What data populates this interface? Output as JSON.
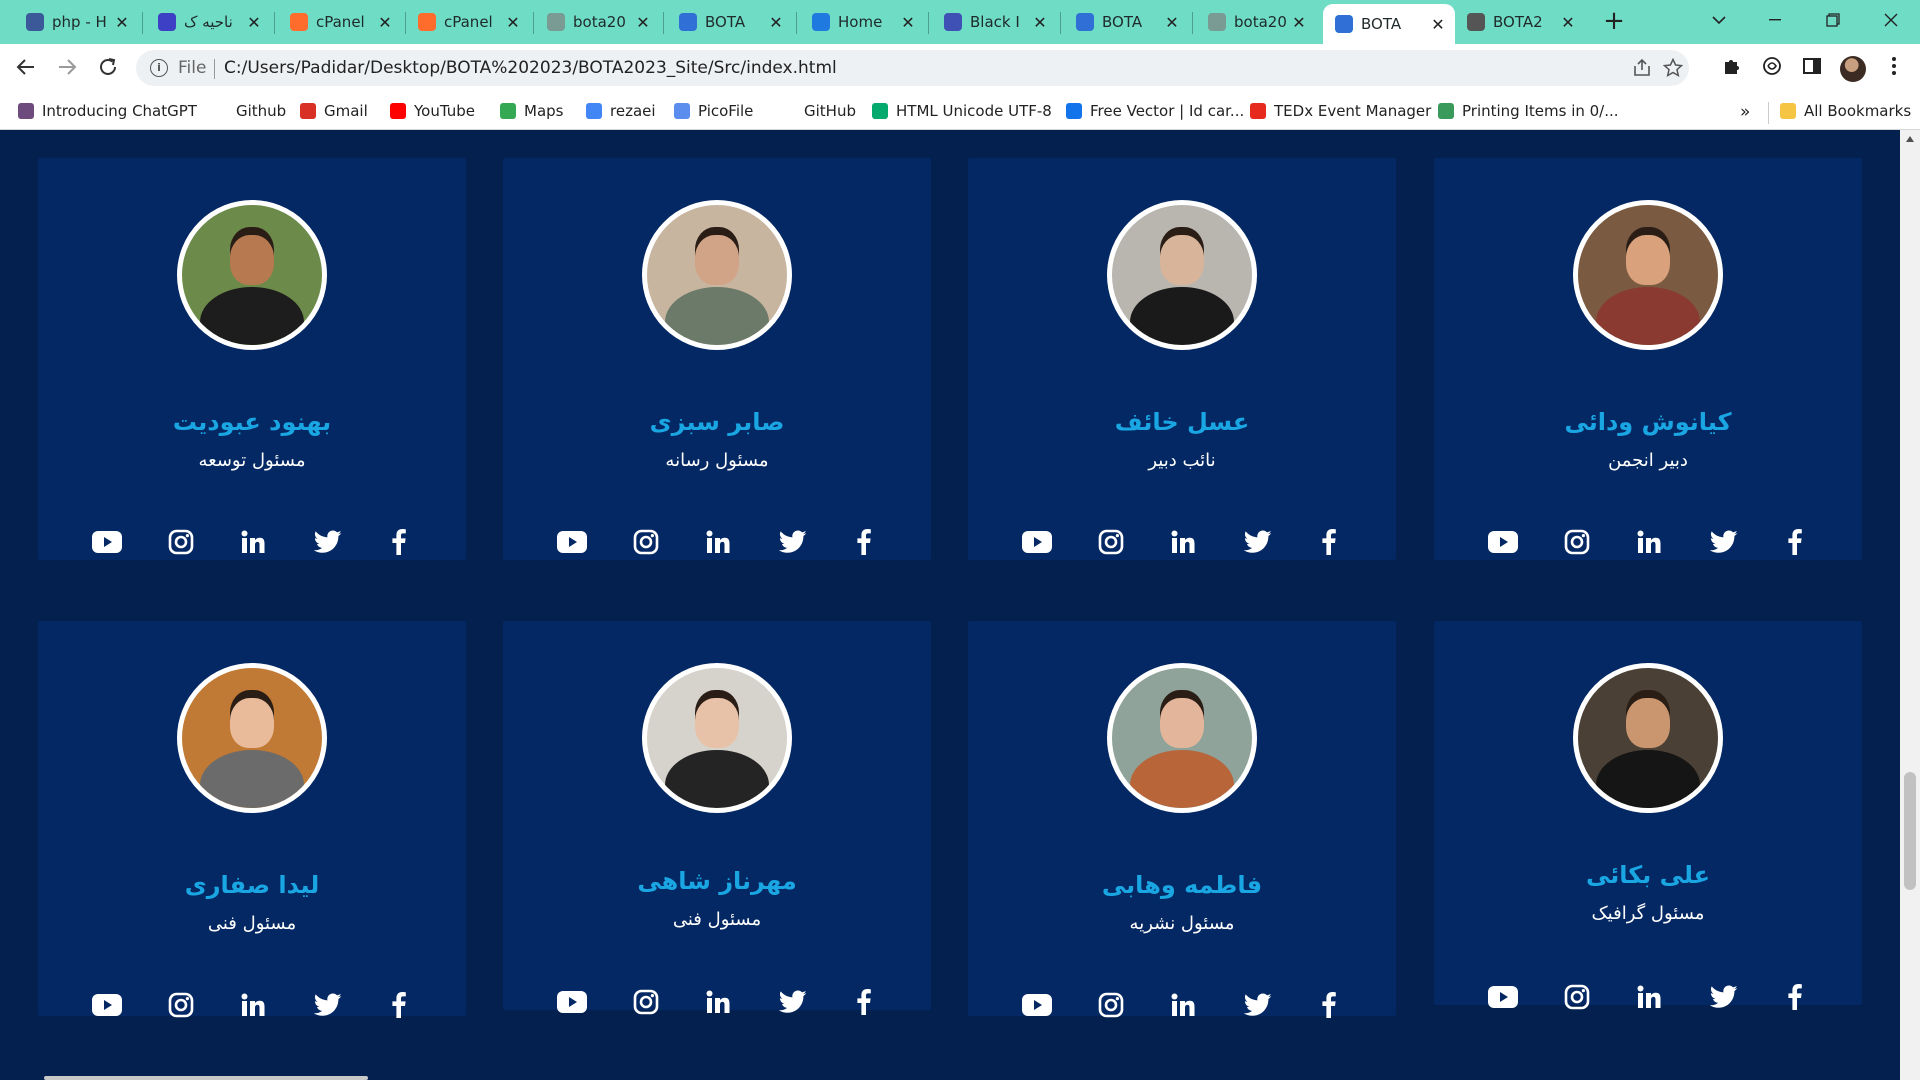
{
  "browser": {
    "tabs": [
      {
        "title": "php - H",
        "icon": "php-doc-icon",
        "color": "#3b5998",
        "active": false
      },
      {
        "title": "ناحیه ک",
        "icon": "circle-p-icon",
        "color": "#3d3fc4",
        "active": false
      },
      {
        "title": "cPanel",
        "icon": "cpanel-icon",
        "color": "#ff6c2c",
        "active": false
      },
      {
        "title": "cPanel",
        "icon": "cpanel-icon",
        "color": "#ff6c2c",
        "active": false
      },
      {
        "title": "bota20",
        "icon": "github-icon",
        "color": "#7a9a94",
        "active": false
      },
      {
        "title": "BOTA",
        "icon": "bota-grid-icon",
        "color": "#2f6fd6",
        "active": false
      },
      {
        "title": "Home",
        "icon": "canva-c-icon",
        "color": "#1f7ae0",
        "active": false
      },
      {
        "title": "Black I",
        "icon": "printer-icon",
        "color": "#3f51b5",
        "active": false
      },
      {
        "title": "BOTA",
        "icon": "bota-grid-icon",
        "color": "#2f6fd6",
        "active": false
      },
      {
        "title": "bota20",
        "icon": "github-icon",
        "color": "#7a9a94",
        "active": false
      },
      {
        "title": "BOTA",
        "icon": "bota-grid-icon",
        "color": "#2f6fd6",
        "active": true
      },
      {
        "title": "BOTA2",
        "icon": "github-icon",
        "color": "#555555",
        "active": false
      }
    ],
    "address": {
      "scheme": "File",
      "url": "C:/Users/Padidar/Desktop/BOTA%202023/BOTA2023_Site/Src/index.html"
    },
    "bookmarks": [
      {
        "label": "Introducing ChatGPT",
        "icon": "chatgpt-icon",
        "color": "#6e4b7d"
      },
      {
        "label": "Github",
        "icon": "github-icon",
        "color": "#ffffff"
      },
      {
        "label": "Gmail",
        "icon": "gmail-icon",
        "color": "#d93025"
      },
      {
        "label": "YouTube",
        "icon": "youtube-icon",
        "color": "#ff0000"
      },
      {
        "label": "Maps",
        "icon": "maps-pin-icon",
        "color": "#34a853"
      },
      {
        "label": "rezaei",
        "icon": "google-g-icon",
        "color": "#4285f4"
      },
      {
        "label": "PicoFile",
        "icon": "picofile-icon",
        "color": "#5b8def"
      },
      {
        "label": "GitHub",
        "icon": "github-icon",
        "color": "#ffffff"
      },
      {
        "label": "HTML Unicode UTF-8",
        "icon": "w3schools-icon",
        "color": "#04aa6d"
      },
      {
        "label": "Free Vector | Id car...",
        "icon": "freepik-icon",
        "color": "#1273eb"
      },
      {
        "label": "TEDx Event Manager",
        "icon": "ted-icon",
        "color": "#e62b1e"
      },
      {
        "label": "Printing Items in 0/...",
        "icon": "link-icon",
        "color": "#3a9a5b"
      }
    ],
    "bookmarks_more": "»",
    "all_bookmarks": "All Bookmarks"
  },
  "team": [
    {
      "name": "کیانوش ودائی",
      "role": "دبیر انجمن",
      "avatar_bg": "#7a5a40",
      "skin": "#d9a27d",
      "shirt": "#8a3a30"
    },
    {
      "name": "عسل خائف",
      "role": "نائب دبیر",
      "avatar_bg": "#b9b6b0",
      "skin": "#d7b49a",
      "shirt": "#1a1a1a"
    },
    {
      "name": "صابر سبزی",
      "role": "مسئول رسانه",
      "avatar_bg": "#c8b5a0",
      "skin": "#d2a487",
      "shirt": "#6c7a6a"
    },
    {
      "name": "بهنود عبودیت",
      "role": "مسئول توسعه",
      "avatar_bg": "#6c8a4a",
      "skin": "#b77a50",
      "shirt": "#1d1d1d"
    },
    {
      "name": "علی بکائی",
      "role": "مسئول گرافیک",
      "avatar_bg": "#4b4035",
      "skin": "#c99670",
      "shirt": "#151515"
    },
    {
      "name": "فاطمه وهابی",
      "role": "مسئول نشریه",
      "avatar_bg": "#8fa39a",
      "skin": "#e3b59a",
      "shirt": "#b8653a"
    },
    {
      "name": "مهرناز شاهی",
      "role": "مسئول فنی",
      "avatar_bg": "#d6d2cc",
      "skin": "#e7c2a8",
      "shirt": "#242424"
    },
    {
      "name": "لیدا صفاری",
      "role": "مسئول فنی",
      "avatar_bg": "#c07a35",
      "skin": "#e9bb9a",
      "shirt": "#6b6b6b"
    }
  ],
  "theme": {
    "accent": "#19a6e3",
    "card_bg": "#042863",
    "page_bg": "#03204f"
  }
}
